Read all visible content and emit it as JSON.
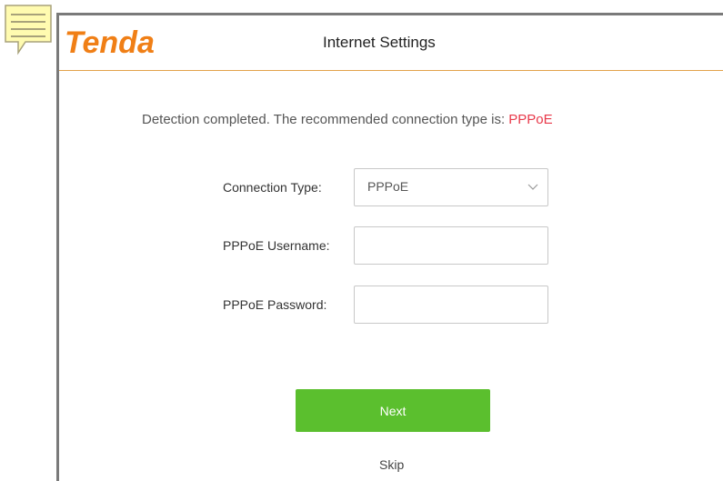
{
  "header": {
    "logo_text": "Tenda",
    "title": "Internet Settings",
    "accent_color": "#f07f16"
  },
  "detection": {
    "message": "Detection completed. The recommended connection type is: ",
    "recommended_type": "PPPoE",
    "highlight_color": "#e8394a"
  },
  "form": {
    "connection_type": {
      "label": "Connection Type:",
      "value": "PPPoE"
    },
    "username": {
      "label": "PPPoE Username:",
      "value": ""
    },
    "password": {
      "label": "PPPoE Password:",
      "value": ""
    }
  },
  "actions": {
    "next_label": "Next",
    "next_color": "#5bbf2e",
    "skip_label": "Skip"
  },
  "icons": {
    "note": "note-icon",
    "dropdown": "chevron-down-icon"
  }
}
